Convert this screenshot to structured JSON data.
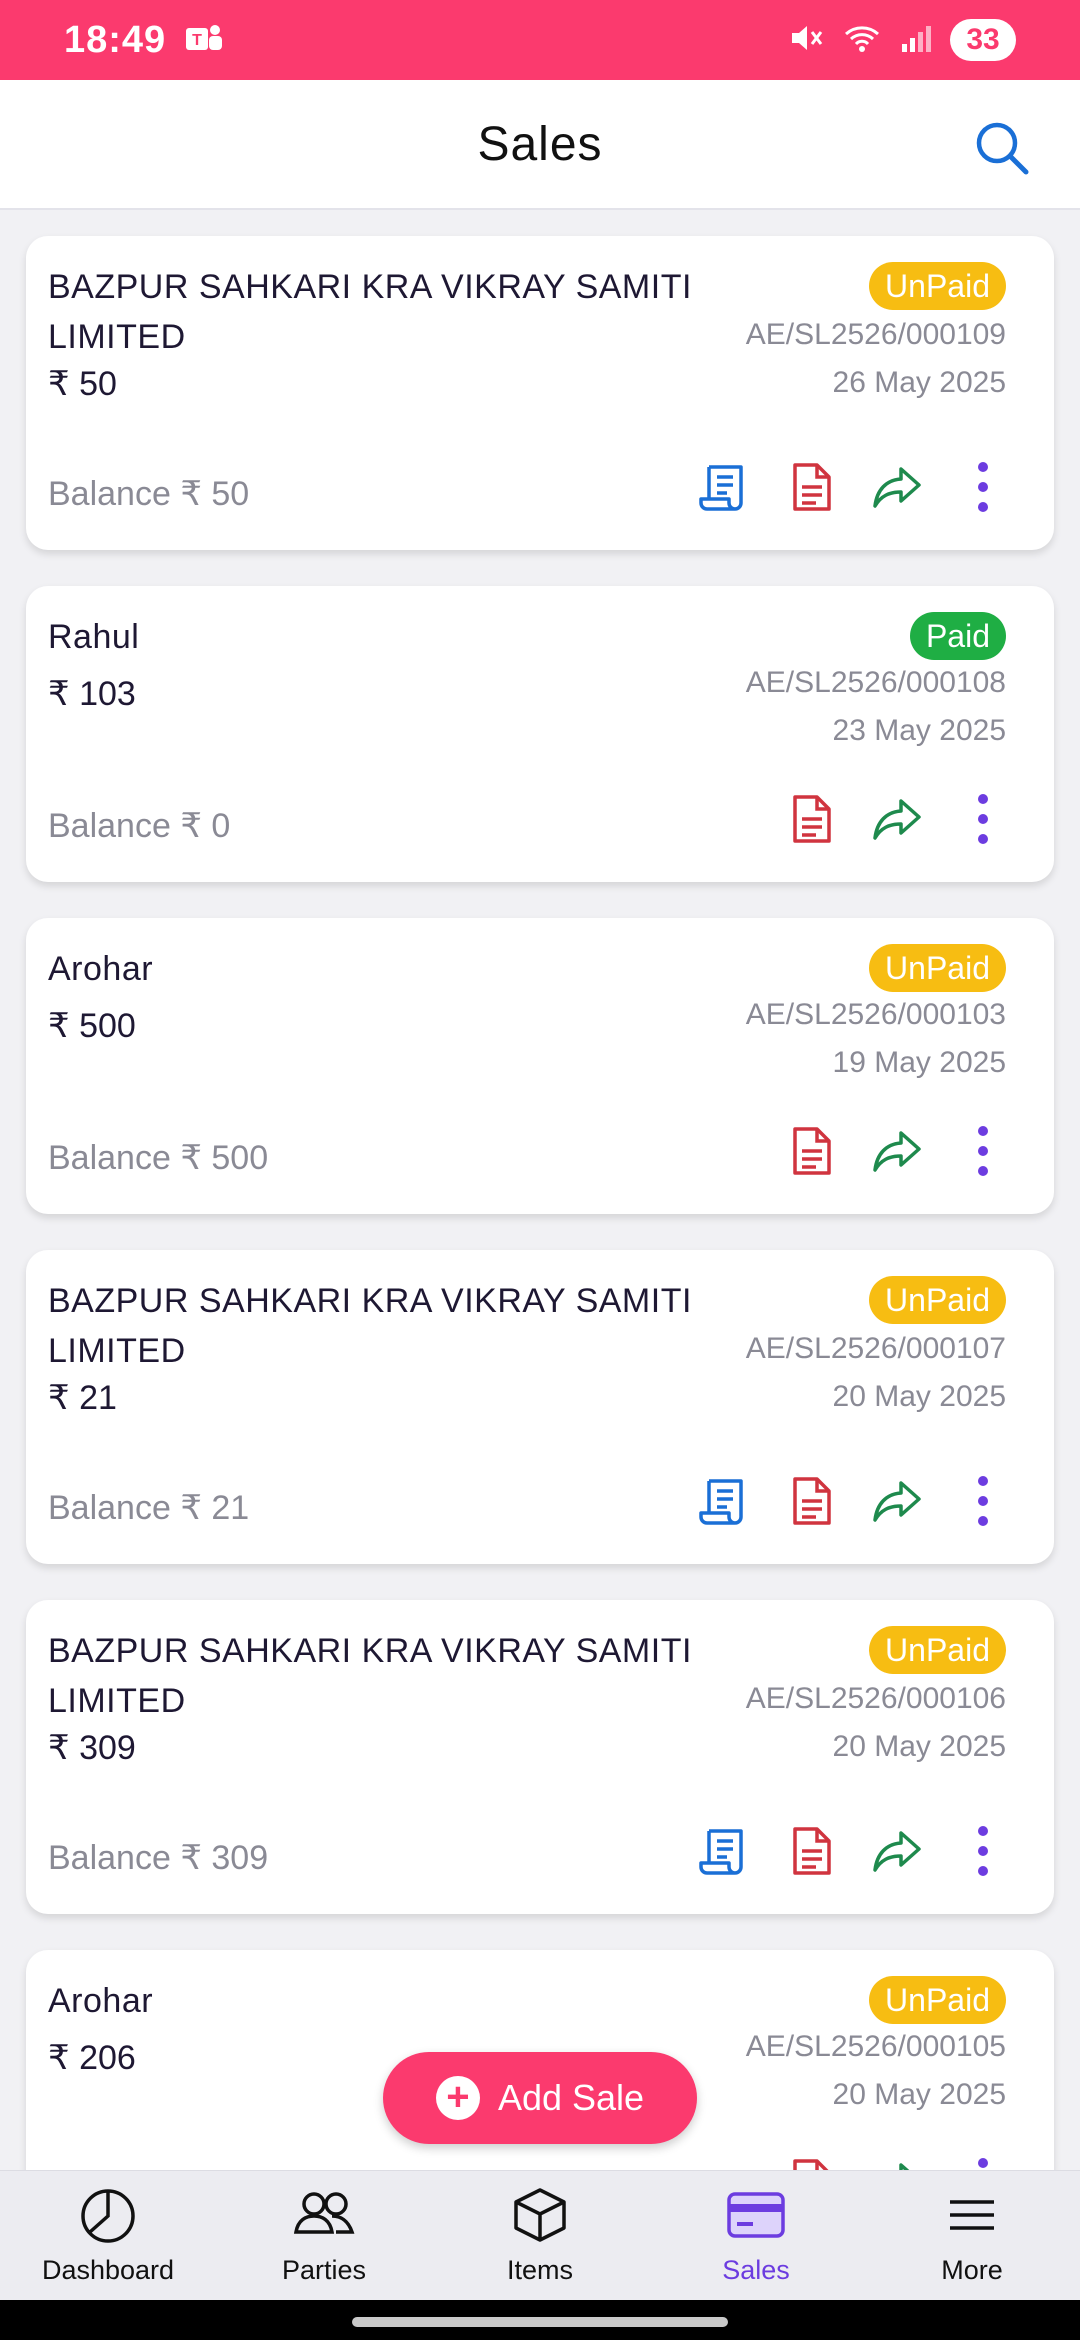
{
  "status_bar": {
    "time": "18:49",
    "battery": "33"
  },
  "header": {
    "title": "Sales"
  },
  "currency_symbol": "₹",
  "balance_label": "Balance",
  "sales": [
    {
      "party": "BAZPUR SAHKARI KRA VIKRAY SAMITI LIMITED",
      "amount": "₹ 50",
      "balance": "Balance ₹ 50",
      "status": "UnPaid",
      "invoice": "AE/SL2526/000109",
      "date": "26 May 2025",
      "has_receipt_icon": true
    },
    {
      "party": "Rahul",
      "amount": "₹ 103",
      "balance": "Balance ₹ 0",
      "status": "Paid",
      "invoice": "AE/SL2526/000108",
      "date": "23 May 2025",
      "has_receipt_icon": false
    },
    {
      "party": "Arohar",
      "amount": "₹ 500",
      "balance": "Balance ₹ 500",
      "status": "UnPaid",
      "invoice": "AE/SL2526/000103",
      "date": "19 May 2025",
      "has_receipt_icon": false
    },
    {
      "party": "BAZPUR SAHKARI KRA VIKRAY SAMITI LIMITED",
      "amount": "₹ 21",
      "balance": "Balance ₹ 21",
      "status": "UnPaid",
      "invoice": "AE/SL2526/000107",
      "date": "20 May 2025",
      "has_receipt_icon": true
    },
    {
      "party": "BAZPUR SAHKARI KRA VIKRAY SAMITI LIMITED",
      "amount": "₹ 309",
      "balance": "Balance ₹ 309",
      "status": "UnPaid",
      "invoice": "AE/SL2526/000106",
      "date": "20 May 2025",
      "has_receipt_icon": true
    },
    {
      "party": "Arohar",
      "amount": "₹ 206",
      "status": "UnPaid",
      "invoice": "AE/SL2526/000105",
      "date": "20 May 2025"
    }
  ],
  "fab": {
    "label": "Add Sale"
  },
  "bottom_nav": [
    {
      "label": "Dashboard",
      "icon": "pie-chart-icon"
    },
    {
      "label": "Parties",
      "icon": "users-icon"
    },
    {
      "label": "Items",
      "icon": "box-icon"
    },
    {
      "label": "Sales",
      "icon": "card-icon",
      "active": true
    },
    {
      "label": "More",
      "icon": "menu-icon"
    }
  ],
  "colors": {
    "accent": "#fb3a6e",
    "active_nav": "#6c3ce0",
    "unpaid": "#f7bd12",
    "paid": "#1fae44",
    "receipt_icon": "#1a6fd6",
    "pdf_icon": "#d0343f",
    "share_icon": "#1e8a4d",
    "menu_dots": "#6c3ce0"
  }
}
